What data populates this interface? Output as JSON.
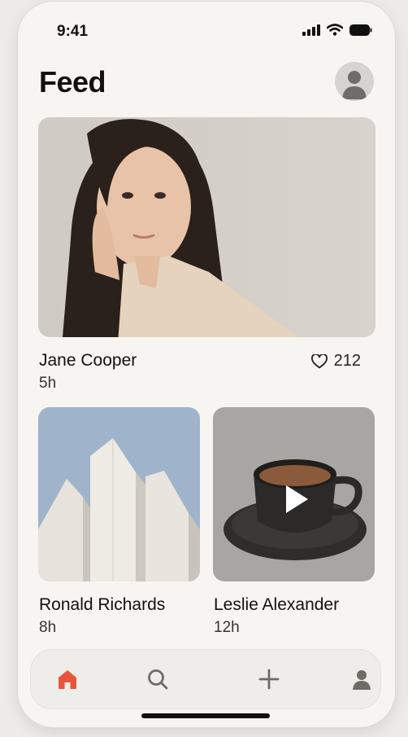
{
  "status_bar": {
    "time": "9:41",
    "icons": [
      "signal-icon",
      "wifi-icon",
      "battery-icon"
    ]
  },
  "header": {
    "title": "Feed",
    "avatar_icon": "user-avatar-icon"
  },
  "posts": [
    {
      "author": "Jane Cooper",
      "time": "5h",
      "likes": "212",
      "image": "portrait-photo"
    },
    {
      "author": "Ronald Richards",
      "time": "8h",
      "image": "architecture-photo"
    },
    {
      "author": "Leslie Alexander",
      "time": "12h",
      "image": "coffee-video",
      "media": "video"
    }
  ],
  "tabbar": {
    "items": [
      {
        "icon": "home-icon",
        "active": true
      },
      {
        "icon": "search-icon",
        "active": false
      },
      {
        "icon": "plus-icon",
        "active": false
      },
      {
        "icon": "profile-icon",
        "active": false
      }
    ],
    "accent": "#e8553a",
    "inactive": "#6f6c67"
  }
}
